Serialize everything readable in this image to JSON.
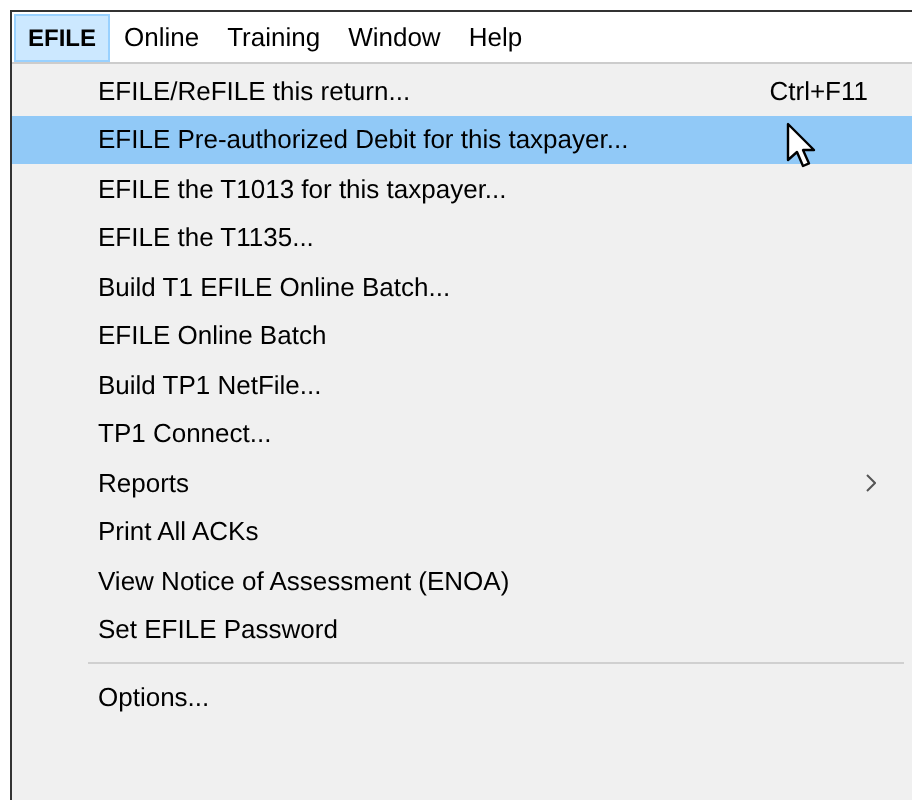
{
  "menu_bar": [
    {
      "label": "EFILE",
      "selected": true
    },
    {
      "label": "Online",
      "selected": false
    },
    {
      "label": "Training",
      "selected": false
    },
    {
      "label": "Window",
      "selected": false
    },
    {
      "label": "Help",
      "selected": false
    }
  ],
  "menu": [
    {
      "kind": "item",
      "label": "EFILE/ReFILE this return...",
      "shortcut": "Ctrl+F11",
      "selected": false
    },
    {
      "kind": "item",
      "label": "EFILE Pre-authorized Debit for this taxpayer...",
      "selected": true
    },
    {
      "kind": "item",
      "label": "EFILE the T1013 for this taxpayer...",
      "selected": false
    },
    {
      "kind": "item",
      "label": "EFILE the T1135...",
      "selected": false
    },
    {
      "kind": "item",
      "label": "Build T1 EFILE Online Batch...",
      "selected": false
    },
    {
      "kind": "item",
      "label": "EFILE Online Batch",
      "selected": false
    },
    {
      "kind": "item",
      "label": "Build TP1 NetFile...",
      "selected": false
    },
    {
      "kind": "item",
      "label": "TP1 Connect...",
      "selected": false
    },
    {
      "kind": "submenu",
      "label": "Reports",
      "selected": false
    },
    {
      "kind": "item",
      "label": "Print All ACKs",
      "selected": false
    },
    {
      "kind": "item",
      "label": "View Notice of Assessment (ENOA)",
      "selected": false
    },
    {
      "kind": "item",
      "label": "Set EFILE Password",
      "selected": false
    },
    {
      "kind": "separator"
    },
    {
      "kind": "item",
      "label": "Options...",
      "selected": false
    }
  ]
}
